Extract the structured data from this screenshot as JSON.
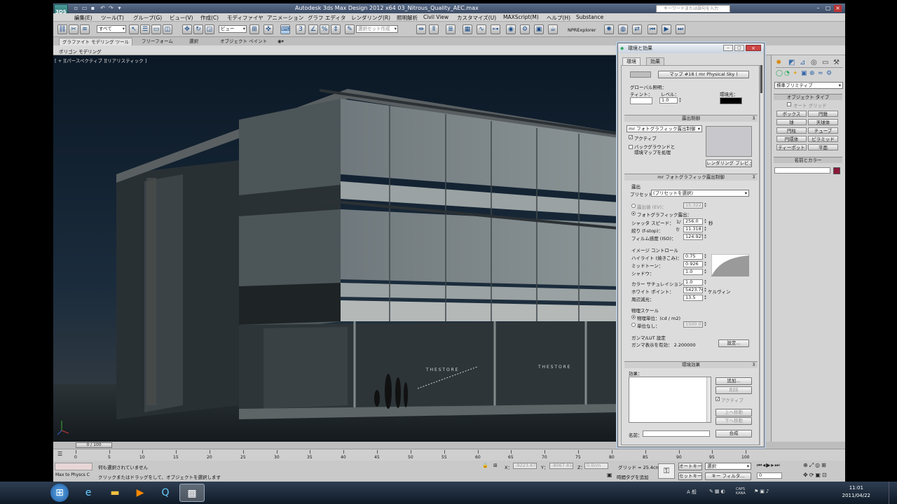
{
  "app": {
    "title": "Autodesk 3ds Max Design 2012 x64     03_Nitrous_Quality_AEC.max",
    "logo": "3DS",
    "search_placeholder": "キーワードまたは語句を入力",
    "qa_icons": [
      "new-icon",
      "open-icon",
      "save-icon",
      "undo-icon",
      "redo-icon",
      "dropdown-icon"
    ]
  },
  "menu": [
    "編集(E)",
    "ツール(T)",
    "グループ(G)",
    "ビュー(V)",
    "作成(C)",
    "モディファイヤ",
    "アニメーション",
    "グラフ エディタ",
    "レンダリング(R)",
    "照明解析",
    "Civil View",
    "カスタマイズ(U)",
    "MAXScript(M)",
    "ヘルプ(H)",
    "Substance"
  ],
  "toolbar": {
    "selection_filter": "すべて",
    "ref_coord": "ビュー",
    "named_selection": "選択セット作成",
    "npr_explorer": "NPRExplorer"
  },
  "ribbon": {
    "tabs": [
      "グラファイト モデリング ツール",
      "フリーフォーム",
      "選択",
      "オブジェクト ペイント"
    ],
    "sub": "ポリゴン モデリング"
  },
  "viewport": {
    "label": "[ + ][パースペクティブ ][リアリスティック ]",
    "store_sign_1": "T H E   S T O R E",
    "store_sign_2": "T H E   S T O R E"
  },
  "command_panel": {
    "dropdown": "標準プリミティブ",
    "object_type_title": "オブジェクト タイプ",
    "autogrid": "オート グリッド",
    "buttons": [
      "ボックス",
      "円錐",
      "球",
      "天球体",
      "円柱",
      "チューブ",
      "円環体",
      "ピラミッド",
      "ティーポット",
      "平面"
    ],
    "name_color_title": "名前とカラー",
    "color": "#8b1a3a"
  },
  "dialog": {
    "title": "環境と効果",
    "tabs": [
      "環境",
      "効果"
    ],
    "map_button": "マップ #18 ( mr Physical Sky )",
    "global_lighting": "グローバル照明：",
    "tint_label": "ティント：",
    "level_label": "レベル：",
    "level_value": "1.0",
    "ambient_label": "環境光：",
    "exposure_section": "露出制御",
    "exposure_dropdown": "mr フォトグラフィック露出制御",
    "active_label": "アクティブ",
    "bg_label_1": "バックグラウンドと",
    "bg_label_2": "環境マップを処理",
    "render_preview": "レンダリング プレビュー",
    "mr_section": "mr フォトグラフィック露出制御",
    "exposure_group": "露出",
    "preset_label": "プリセット：",
    "preset_value": "(プリセットを選択)",
    "ev_label": "露出値 (EV)：",
    "ev_value": "15.322",
    "photo_label": "フォトグラフィック露出：",
    "shutter_label": "シャッタ スピード：",
    "shutter_prefix": "1/",
    "shutter_value": "256.0",
    "shutter_unit": "秒",
    "fstop_label": "絞り (f-stop)：",
    "fstop_prefix": "f/",
    "fstop_value": "11.318",
    "iso_label": "フィルム感度 (ISO)：",
    "iso_value": "124.925",
    "image_control": "イメージ コントロール",
    "highlight_label": "ハイライト (焼きこみ)：",
    "highlight_value": "0.75",
    "midtone_label": "ミッドトーン：",
    "midtone_value": "0.926",
    "shadow_label": "シャドウ：",
    "shadow_value": "1.0",
    "saturation_label": "カラー サチュレイション：",
    "saturation_value": "1.0",
    "whitepoint_label": "ホワイト ポイント：",
    "whitepoint_value": "5423.76",
    "whitepoint_unit": "ケルヴィン",
    "vignetting_label": "周辺減光：",
    "vignetting_value": "13.5",
    "physical_scale": "物理スケール",
    "physical_units": "物理単位：(cd / m2)",
    "unitless": "単位なし：",
    "unitless_value": "1500.0",
    "gamma_title": "ガンマ/LUT 設定",
    "gamma_value": "ガンマ表示を有効：  2.200000",
    "gamma_button": "設定...",
    "atmosphere_section": "環境効果",
    "effects_label": "効果：",
    "add_button": "追加...",
    "delete_button": "削除",
    "active2_label": "アクティブ",
    "moveup_button": "上へ移動",
    "movedown_button": "下へ移動",
    "name_label": "名前：",
    "merge_button": "合成"
  },
  "timeline": {
    "slider": "0 / 100",
    "ticks": [
      "0",
      "5",
      "10",
      "15",
      "20",
      "25",
      "30",
      "35",
      "40",
      "45",
      "50",
      "55",
      "60",
      "65",
      "70",
      "75",
      "80",
      "85",
      "90",
      "95",
      "100"
    ]
  },
  "status": {
    "maxscript": "Max to Physcs C",
    "msg1": "何も選択されていません",
    "msg2": "クリックまたはドラッグをして、オブジェクトを選択します",
    "x_label": "X：",
    "x_value": "-9223.875",
    "y_label": "Y：",
    "y_value": "-8067.81c",
    "z_label": "Z：",
    "z_value": "0.0cm",
    "grid": "グリッド = 25.4cm",
    "add_time_tag": "時間タグを追加",
    "auto_key": "オートキー",
    "set_key": "セットキー",
    "selection": "選択",
    "key_filter": "キー フィルタ...",
    "frame": "0"
  },
  "taskbar": {
    "time": "11:01",
    "date": "2011/04/22",
    "lang": "A 般",
    "ime": "CAPS KANA"
  }
}
